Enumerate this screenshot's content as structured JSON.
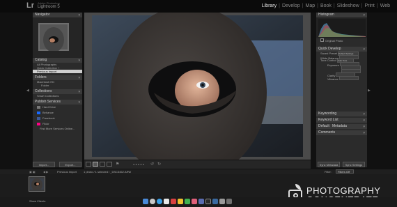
{
  "app": {
    "logo": "Lr",
    "subtitle": "Adobe Photoshop",
    "name": "Lightroom 5"
  },
  "modules": [
    {
      "label": "Library",
      "active": true
    },
    {
      "label": "Develop",
      "active": false
    },
    {
      "label": "Map",
      "active": false
    },
    {
      "label": "Book",
      "active": false
    },
    {
      "label": "Slideshow",
      "active": false
    },
    {
      "label": "Print",
      "active": false
    },
    {
      "label": "Web",
      "active": false
    }
  ],
  "left": {
    "navigator": "Navigator",
    "catalog": {
      "title": "Catalog",
      "items": [
        "All Photographs",
        "Quick Collection +",
        "Previous Import"
      ]
    },
    "folders": {
      "title": "Folders",
      "drive": "Macintosh HD",
      "items": [
        "Folder"
      ]
    },
    "collections": {
      "title": "Collections",
      "items": [
        "Smart Collections"
      ]
    },
    "publish": {
      "title": "Publish Services",
      "items": [
        "Hard Drive",
        "Behance",
        "Facebook",
        "Flickr"
      ],
      "find_more": "Find More Services Online..."
    },
    "import_btn": "Import...",
    "export_btn": "Export..."
  },
  "right": {
    "histogram": "Histogram",
    "original_photo": "Original Photo",
    "quick_develop": {
      "title": "Quick Develop",
      "preset_label": "Saved Preset",
      "preset_value": "Default Settings",
      "white_balance": "White Balance",
      "tone_control": "Tone Control",
      "auto_tone": "Auto Tone",
      "exposure": "Exposure",
      "clarity": "Clarity",
      "vibrance": "Vibrance"
    },
    "keywording": "Keywording",
    "keyword_list": "Keyword List",
    "metadata": "Metadata",
    "metadata_default": "Default",
    "comments": "Comments",
    "sync_metadata": "Sync Metadata",
    "sync_settings": "Sync Settings"
  },
  "filmstrip": {
    "source": "Previous Import",
    "info": "1 photo / 1 selected / _DSC3462.ARW",
    "filter_label": "Filter :",
    "filter_value": "Filters Off"
  },
  "watermark": {
    "line1": "PHOTOGRAPHY",
    "line2": "CONCENTRATE"
  },
  "dock": {
    "label": "Show Clients"
  }
}
